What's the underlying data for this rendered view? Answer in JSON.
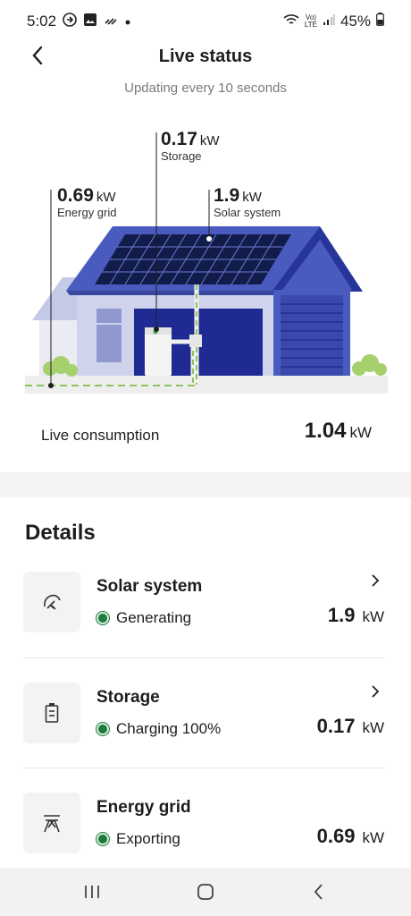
{
  "status_bar": {
    "time": "5:02",
    "battery": "45%",
    "network": "LTE"
  },
  "header": {
    "title": "Live status",
    "subtitle": "Updating every 10 seconds"
  },
  "illustration": {
    "storage": {
      "value": "0.17",
      "unit": "kW",
      "caption": "Storage"
    },
    "grid": {
      "value": "0.69",
      "unit": "kW",
      "caption": "Energy grid"
    },
    "solar": {
      "value": "1.9",
      "unit": "kW",
      "caption": "Solar system"
    }
  },
  "consumption": {
    "label": "Live consumption",
    "value": "1.04",
    "unit": "kW"
  },
  "details": {
    "title": "Details",
    "cards": [
      {
        "name": "Solar system",
        "status": "Generating",
        "value": "1.9",
        "unit": "kW",
        "icon": "solar-icon"
      },
      {
        "name": "Storage",
        "status": "Charging 100%",
        "value": "0.17",
        "unit": "kW",
        "icon": "battery-icon"
      },
      {
        "name": "Energy grid",
        "status": "Exporting",
        "value": "0.69",
        "unit": "kW",
        "icon": "grid-pylon-icon"
      }
    ]
  },
  "colors": {
    "accent_green": "#1e7b3f",
    "house_blue": "#27349a",
    "roof_blue": "#4a5bbf"
  }
}
